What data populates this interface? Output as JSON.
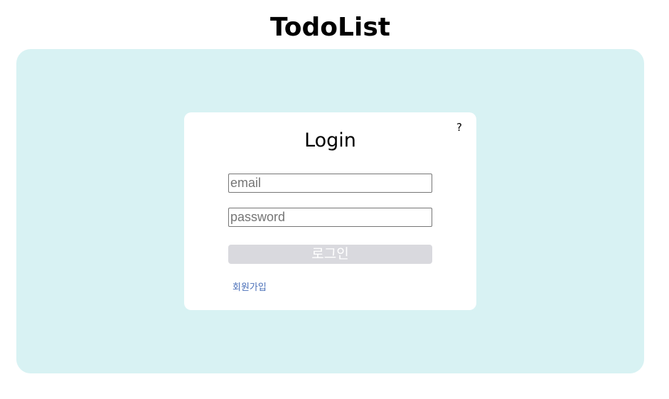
{
  "app": {
    "title": "TodoList"
  },
  "login_card": {
    "title": "Login",
    "help_label": "?",
    "email_placeholder": "email",
    "email_value": "",
    "password_placeholder": "password",
    "password_value": "",
    "login_button_label": "로그인",
    "signup_link_label": "회원가입"
  },
  "colors": {
    "panel_background": "#d8f2f3",
    "card_background": "#ffffff",
    "login_button_disabled": "#d9d9de",
    "signup_link": "#4a6fb8"
  }
}
